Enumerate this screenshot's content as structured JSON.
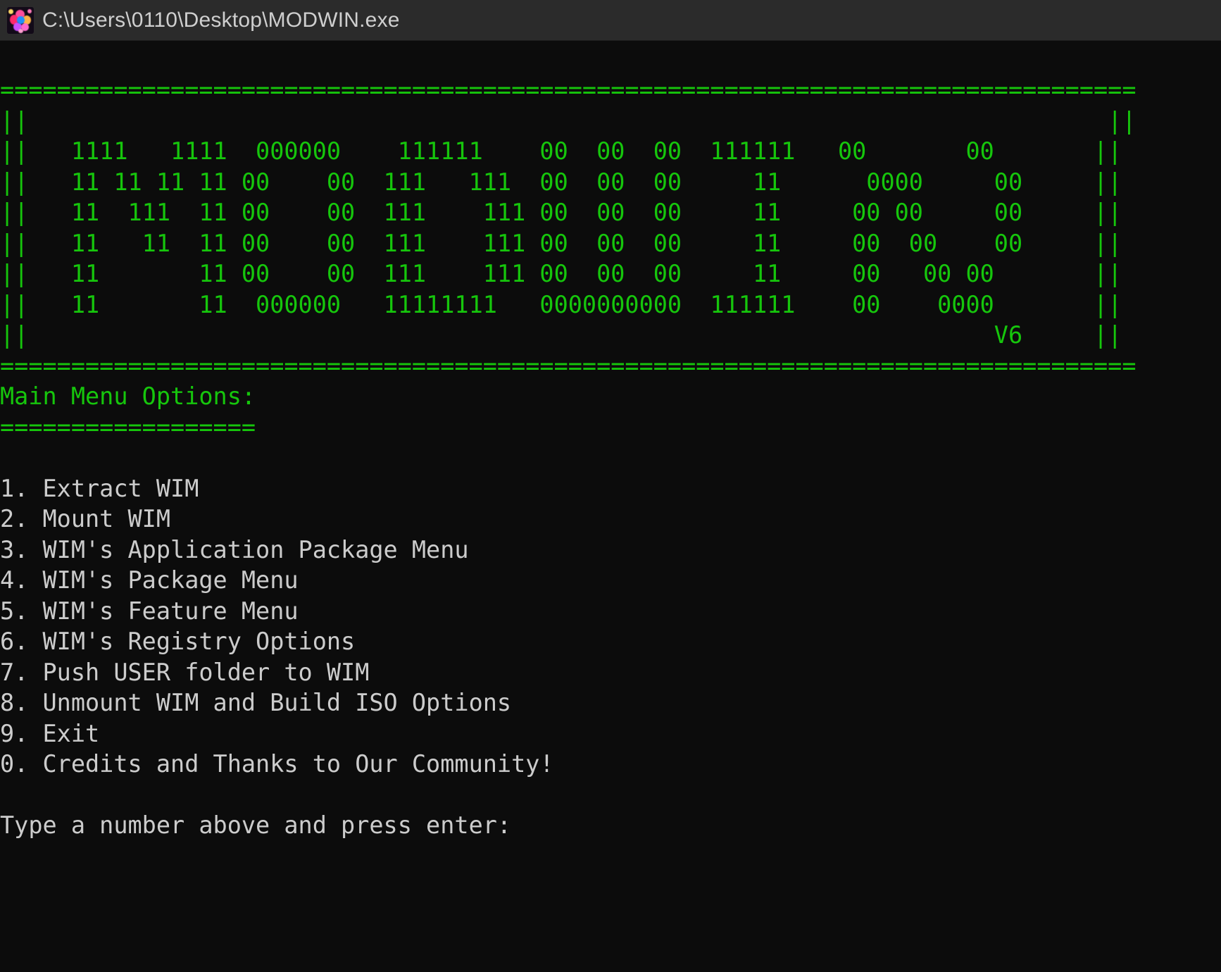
{
  "window": {
    "title": "C:\\Users\\0110\\Desktop\\MODWIN.exe",
    "icon": "modwin-app-icon",
    "titlebar_bg": "#2b2b2b",
    "titlebar_text_color": "#cfcfcf"
  },
  "console": {
    "background": "#0c0c0c",
    "green": "#16c60c",
    "gray": "#cccccc",
    "banner": {
      "top_rule": "================================================================================",
      "bottom_rule": "================================================================================",
      "side_border": "||",
      "version": "V6",
      "art_rows": [
        "||                                                                            ||",
        "||   1111   1111  000000    111111    00  00  00  111111   00       00       ||",
        "||   11 11 11 11 00    00  111   111  00  00  00     11      0000     00     ||",
        "||   11  111  11 00    00  111    111 00  00  00     11     00 00     00     ||",
        "||   11   11  11 00    00  111    111 00  00  00     11     00  00    00     ||",
        "||   11       11 00    00  111    111 00  00  00     11     00   00 00       ||",
        "||   11       11  000000   11111111   0000000000  111111    00    0000       ||",
        "||                                                                    V6     ||"
      ]
    },
    "menu_heading": "Main Menu Options:",
    "menu_heading_rule": "==================",
    "menu_items": [
      "1. Extract WIM",
      "2. Mount WIM",
      "3. WIM's Application Package Menu",
      "4. WIM's Package Menu",
      "5. WIM's Feature Menu",
      "6. WIM's Registry Options",
      "7. Push USER folder to WIM",
      "8. Unmount WIM and Build ISO Options",
      "9. Exit",
      "0. Credits and Thanks to Our Community!"
    ],
    "prompt": "Type a number above and press enter:"
  }
}
